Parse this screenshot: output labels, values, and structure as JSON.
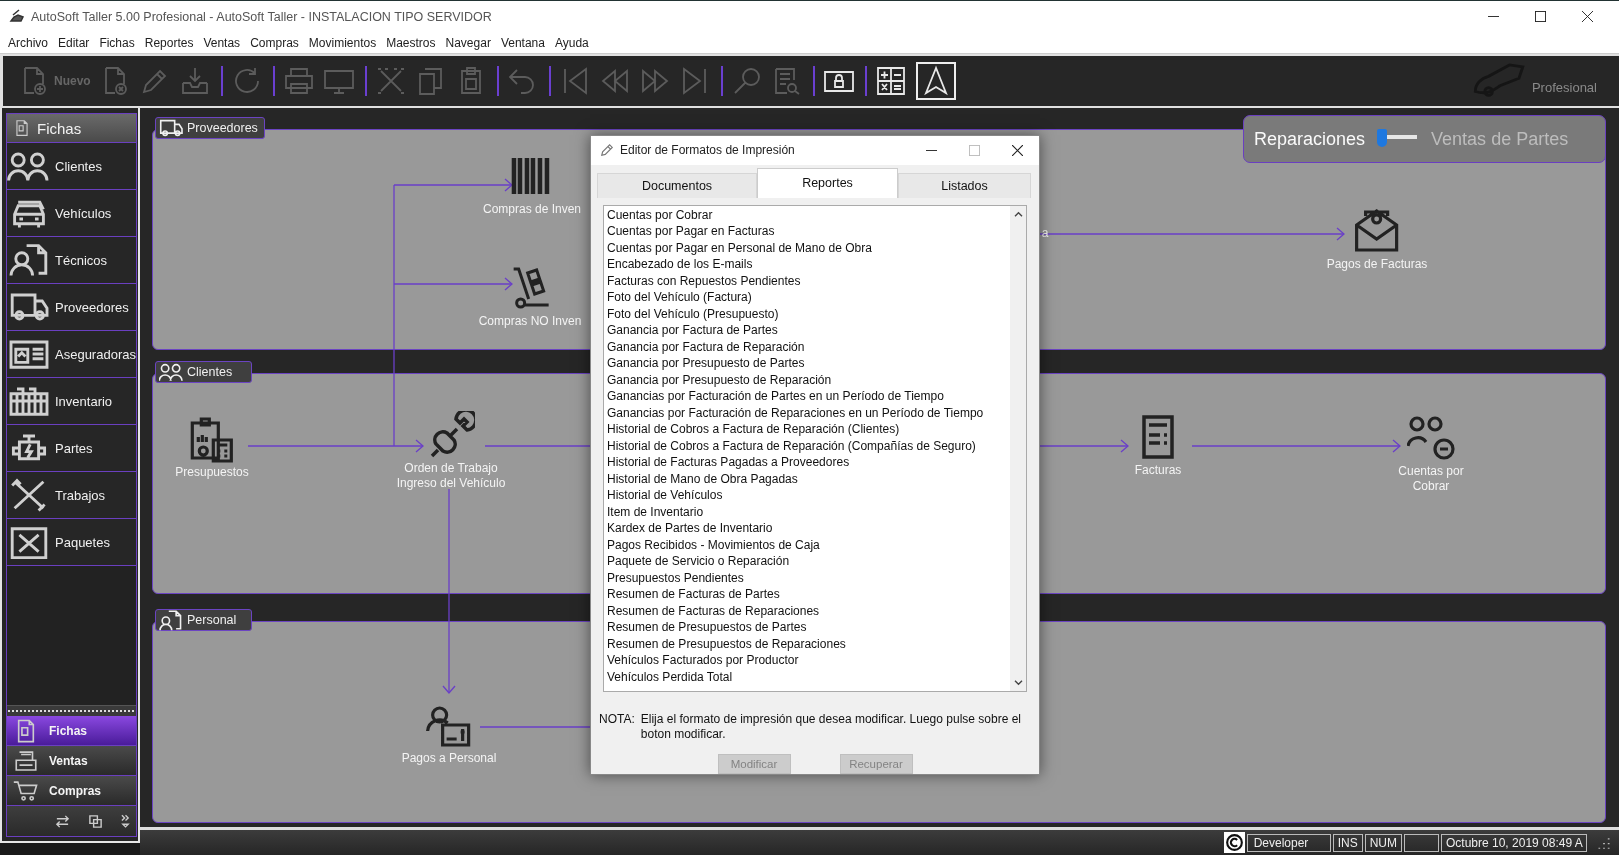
{
  "window": {
    "title": "AutoSoft Taller 5.00 Profesional - AutoSoft Taller - INSTALACION TIPO SERVIDOR"
  },
  "menu": [
    "Archivo",
    "Editar",
    "Fichas",
    "Reportes",
    "Ventas",
    "Compras",
    "Movimientos",
    "Maestros",
    "Navegar",
    "Ventana",
    "Ayuda"
  ],
  "toolbar": {
    "groups": [
      {
        "buttons": [
          {
            "label": "Nuevo",
            "disabled": true
          },
          {
            "disabled": true
          },
          {
            "disabled": true
          },
          {
            "disabled": true
          }
        ]
      },
      {
        "buttons": [
          {
            "disabled": true
          }
        ]
      },
      {
        "buttons": [
          {
            "disabled": true
          },
          {
            "disabled": true
          }
        ]
      },
      {
        "buttons": [
          {
            "disabled": true
          },
          {
            "disabled": true
          },
          {
            "disabled": true
          }
        ]
      },
      {
        "buttons": [
          {
            "disabled": true
          }
        ]
      },
      {
        "buttons": [
          {
            "disabled": true
          },
          {
            "disabled": true
          },
          {
            "disabled": true
          },
          {
            "disabled": true
          }
        ]
      },
      {
        "buttons": [
          {
            "disabled": true
          },
          {
            "disabled": true
          }
        ]
      },
      {
        "buttons": [
          {
            "disabled": false
          }
        ]
      },
      {
        "buttons": [
          {
            "disabled": false
          },
          {
            "disabled": false
          }
        ]
      }
    ],
    "edition": "Profesional"
  },
  "sidebar": {
    "header": "Fichas",
    "items": [
      "Clientes",
      "Vehículos",
      "Técnicos",
      "Proveedores",
      "Aseguradoras",
      "Inventario",
      "Partes",
      "Trabajos",
      "Paquetes"
    ],
    "groups": [
      {
        "label": "Fichas",
        "selected": true
      },
      {
        "label": "Ventas",
        "selected": false
      },
      {
        "label": "Compras",
        "selected": false
      }
    ]
  },
  "mode_switch": {
    "options": [
      {
        "label": "Reparaciones",
        "selected": true
      },
      {
        "label": "Ventas de Partes",
        "selected": false
      }
    ]
  },
  "panels": [
    {
      "title": "Proveedores",
      "nodes": [
        {
          "label": "Compras de Inven"
        },
        {
          "label": "Compras NO Inven"
        },
        {
          "label": "a"
        },
        {
          "label": "Pagos de Facturas"
        }
      ]
    },
    {
      "title": "Clientes",
      "nodes": [
        {
          "label": "Presupuestos"
        },
        {
          "label": "Orden de Trabajo Ingreso del Vehículo"
        },
        {
          "label": "Facturas"
        },
        {
          "label": "Cuentas por Cobrar"
        }
      ]
    },
    {
      "title": "Personal",
      "nodes": [
        {
          "label": "Pagos a Personal"
        }
      ]
    }
  ],
  "dialog": {
    "title": "Editor de Formatos de Impresión",
    "tabs": [
      {
        "label": "Documentos",
        "selected": false
      },
      {
        "label": "Reportes",
        "selected": true
      },
      {
        "label": "Listados",
        "selected": false
      }
    ],
    "list": [
      "Cuentas por Cobrar",
      "Cuentas por Pagar en Facturas",
      "Cuentas por Pagar en Personal de Mano de Obra",
      "Encabezado de los E-mails",
      "Facturas con Repuestos Pendientes",
      "Foto del Vehículo (Factura)",
      "Foto del Vehículo (Presupuesto)",
      "Ganancia por Factura de Partes",
      "Ganancia por Factura de Reparación",
      "Ganancia por Presupuesto de Partes",
      "Ganancia por Presupuesto de Reparación",
      "Ganancias por Facturación de Partes en un Período de Tiempo",
      "Ganancias por Facturación de Reparaciones en un Período de Tiempo",
      "Historial de Cobros a Factura de Reparación (Clientes)",
      "Historial de Cobros a Factura de Reparación (Compañías de Seguro)",
      "Historial de Facturas Pagadas a Proveedores",
      "Historial de Mano de Obra Pagadas",
      "Historial de Vehículos",
      "Item de Inventario",
      "Kardex de Partes de Inventario",
      "Pagos Recibidos - Movimientos de Caja",
      "Paquete de Servicio o Reparación",
      "Presupuestos Pendientes",
      "Resumen de Facturas de Partes",
      "Resumen de Facturas de Reparaciones",
      "Resumen de Presupuestos de Partes",
      "Resumen de Presupuestos de Reparaciones",
      "Vehículos Facturados por Productor",
      "Vehículos Perdida Total"
    ],
    "note_label": "NOTA:",
    "note": "Elija el formato de impresión que desea modificar. Luego pulse sobre el boton modificar.",
    "buttons": [
      {
        "label": "Modificar",
        "disabled": true
      },
      {
        "label": "Recuperar",
        "disabled": true
      }
    ]
  },
  "status_bar": {
    "user": "Developer",
    "ins": "INS",
    "num": "NUM",
    "datetime": "Octubre 10, 2019 08:49 A"
  }
}
